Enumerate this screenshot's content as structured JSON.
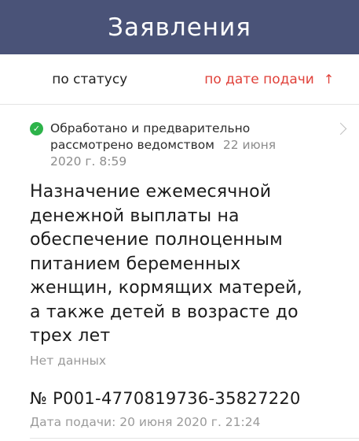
{
  "header": {
    "title": "Заявления"
  },
  "sort": {
    "options": [
      {
        "label": "по статусу",
        "active": false
      },
      {
        "label": "по дате подачи",
        "active": true,
        "arrow": "↑"
      }
    ]
  },
  "application": {
    "status_text": "Обработано и предварительно рассмотрено ведомством",
    "status_date": "22 июня",
    "status_time": "2020 г. 8:59",
    "title": "Назначение ежемесячной денежной выплаты на обеспечение полноценным питанием беременных женщин, кормящих матерей, а также детей в возрасте до трех лет",
    "subtitle": "Нет данных",
    "number": "№ P001-4770819736-35827220",
    "submitted": "Дата подачи: 20 июня 2020 г. 21:24"
  },
  "colors": {
    "header_bg": "#4a5378",
    "accent": "#e0413a",
    "status_ok": "#2db34a"
  },
  "icons": {
    "status": "check-circle-icon",
    "open": "chevron-right-icon",
    "sort_direction": "arrow-up-icon"
  }
}
